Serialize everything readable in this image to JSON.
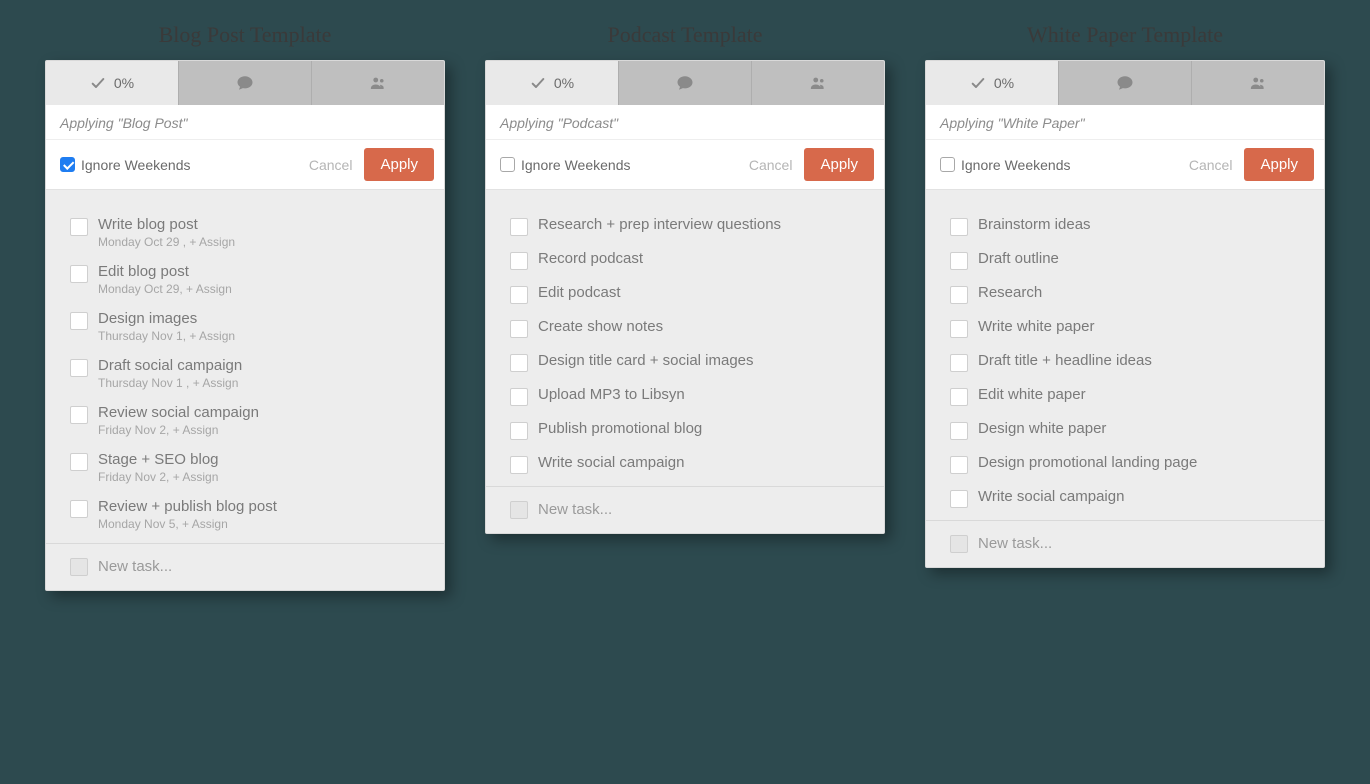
{
  "columns": [
    {
      "title": "Blog Post Template",
      "applying_text": "Applying \"Blog Post\"",
      "progress": "0%",
      "ignore_label": "Ignore Weekends",
      "ignore_checked": true,
      "cancel_label": "Cancel",
      "apply_label": "Apply",
      "new_task": "New task...",
      "tasks": [
        {
          "title": "Write blog post",
          "meta": "Monday Oct 29 ,  + Assign"
        },
        {
          "title": "Edit blog post",
          "meta": "Monday Oct 29,  + Assign"
        },
        {
          "title": "Design images",
          "meta": "Thursday Nov 1,  + Assign"
        },
        {
          "title": "Draft social campaign",
          "meta": "Thursday Nov 1 ,  + Assign"
        },
        {
          "title": "Review social campaign",
          "meta": "Friday Nov 2,  + Assign"
        },
        {
          "title": "Stage + SEO blog",
          "meta": "Friday Nov 2,  + Assign"
        },
        {
          "title": "Review + publish blog post",
          "meta": "Monday Nov 5,  + Assign"
        }
      ]
    },
    {
      "title": "Podcast Template",
      "applying_text": "Applying \"Podcast\"",
      "progress": "0%",
      "ignore_label": "Ignore Weekends",
      "ignore_checked": false,
      "cancel_label": "Cancel",
      "apply_label": "Apply",
      "new_task": "New task...",
      "tasks": [
        {
          "title": "Research + prep interview questions"
        },
        {
          "title": "Record podcast"
        },
        {
          "title": "Edit podcast"
        },
        {
          "title": "Create show notes"
        },
        {
          "title": "Design title card + social images"
        },
        {
          "title": "Upload MP3 to Libsyn"
        },
        {
          "title": "Publish promotional blog"
        },
        {
          "title": "Write social campaign"
        }
      ]
    },
    {
      "title": "White Paper Template",
      "applying_text": "Applying \"White Paper\"",
      "progress": "0%",
      "ignore_label": "Ignore Weekends",
      "ignore_checked": false,
      "cancel_label": "Cancel",
      "apply_label": "Apply",
      "new_task": "New task...",
      "tasks": [
        {
          "title": "Brainstorm ideas"
        },
        {
          "title": "Draft outline"
        },
        {
          "title": "Research"
        },
        {
          "title": "Write white paper"
        },
        {
          "title": "Draft title + headline ideas"
        },
        {
          "title": "Edit white paper"
        },
        {
          "title": "Design white paper"
        },
        {
          "title": "Design promotional landing page"
        },
        {
          "title": "Write social campaign"
        }
      ]
    }
  ],
  "icons": {
    "check": "check-icon",
    "comment": "comment-icon",
    "people": "people-icon"
  },
  "colors": {
    "accent": "#d7694b",
    "checkbox_active": "#1f7df1"
  }
}
